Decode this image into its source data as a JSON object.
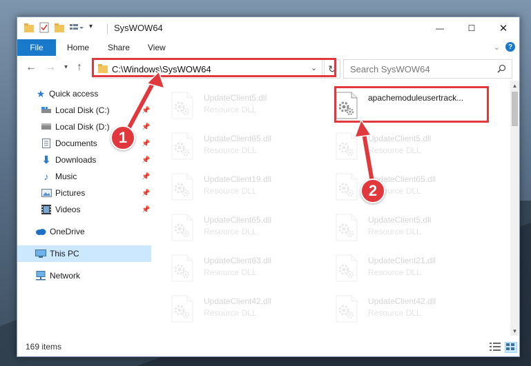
{
  "window": {
    "title": "SysWOW64",
    "controls": {
      "minimize": "—",
      "maximize": "☐",
      "close": "✕"
    }
  },
  "ribbon": {
    "tabs": [
      "File",
      "Home",
      "Share",
      "View"
    ],
    "help": "?"
  },
  "nav": {
    "address": "C:\\Windows\\SysWOW64",
    "search_placeholder": "Search SysWOW64"
  },
  "sidebar": {
    "items": [
      {
        "label": "Quick access",
        "icon": "star-icon",
        "pinned": false
      },
      {
        "label": "Local Disk (C:)",
        "icon": "drive-icon",
        "pinned": true
      },
      {
        "label": "Local Disk (D:)",
        "icon": "drive-icon",
        "pinned": true
      },
      {
        "label": "Documents",
        "icon": "documents-icon",
        "pinned": true
      },
      {
        "label": "Downloads",
        "icon": "download-icon",
        "pinned": true
      },
      {
        "label": "Music",
        "icon": "music-icon",
        "pinned": true
      },
      {
        "label": "Pictures",
        "icon": "pictures-icon",
        "pinned": true
      },
      {
        "label": "Videos",
        "icon": "videos-icon",
        "pinned": true
      },
      {
        "label": "OneDrive",
        "icon": "cloud-icon",
        "pinned": false
      },
      {
        "label": "This PC",
        "icon": "computer-icon",
        "pinned": false,
        "selected": true
      },
      {
        "label": "Network",
        "icon": "network-icon",
        "pinned": false
      }
    ]
  },
  "files": {
    "left_column": [
      {
        "name": "UpdateClient5.dll",
        "type": "Resource DLL"
      },
      {
        "name": "UpdateClient65.dll",
        "type": "Resource DLL"
      },
      {
        "name": "UpdateClient19.dll",
        "type": "Resource DLL"
      },
      {
        "name": "UpdateClient65.dll",
        "type": "Resource DLL"
      },
      {
        "name": "UpdateClient63.dll",
        "type": "Resource DLL"
      },
      {
        "name": "UpdateClient42.dll",
        "type": "Resource DLL"
      }
    ],
    "right_column": [
      {
        "name": "apachemoduleusertrack...",
        "type": ""
      },
      {
        "name": "UpdateClient5.dll",
        "type": "Resource DLL"
      },
      {
        "name": "UpdateClient65.dll",
        "type": "Resource DLL"
      },
      {
        "name": "UpdateClient5.dll",
        "type": "Resource DLL"
      },
      {
        "name": "UpdateClient21.dll",
        "type": "Resource DLL"
      },
      {
        "name": "UpdateClient42.dll",
        "type": "Resource DLL"
      }
    ]
  },
  "status": {
    "item_count": "169 items"
  },
  "annotations": [
    {
      "number": "1",
      "color": "#e0383c"
    },
    {
      "number": "2",
      "color": "#e0383c"
    }
  ]
}
